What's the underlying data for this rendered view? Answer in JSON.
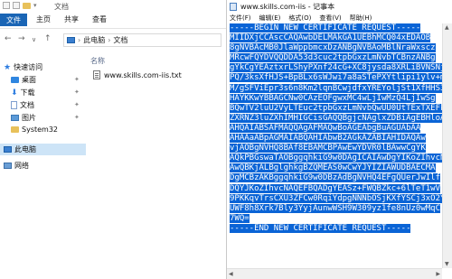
{
  "explorer": {
    "window_title": "文档",
    "tabs": [
      "文件",
      "主页",
      "共享",
      "查看"
    ],
    "address": {
      "part1": "此电脑",
      "part2": "文档"
    },
    "nav": {
      "quick_access": "快速访问",
      "items": [
        {
          "label": "桌面"
        },
        {
          "label": "下载"
        },
        {
          "label": "文档"
        },
        {
          "label": "图片"
        },
        {
          "label": "System32"
        }
      ],
      "this_pc": "此电脑",
      "network": "网络"
    },
    "column_name": "名称",
    "file_name": "www.skills.com-iis.txt"
  },
  "notepad": {
    "window_title": "www.skills.com-iis - 记事本",
    "menu": [
      "文件(F)",
      "编辑(E)",
      "格式(O)",
      "查看(V)",
      "帮助(H)"
    ],
    "lines": [
      "-----BEGIN NEW CERTIFICATE REQUEST-----",
      "MIIDXjCCAscCAQAwbDELMAkGA1UEBhMCQ04xEDAOB",
      "8gNVBAcMB0JlaWppbmcxDzANBgNVBAoMBlNraWxscz",
      "MRcwFQYDVQQDDA53d3cuc2tpbGxzLmNvbTCBnzANBg",
      "gYkCgYEAztxrLShyPXnf24cG+XC8jysda8XRLiBVNSNjaX8",
      "PQ/3ksXfHJS+BpBLx6sWJwi7a8aSTePXYtlipi1ylv+mtCfU",
      "M/gSFViEpr3s6n8Km2lqnBCwjdfxYREYoljSt1XfHHS3wHd",
      "HAYKKwYBBAGCNw0CAzEOFgwxMC4wLjIwMzQ4LjIwSg",
      "BQwTV2luU2VyLTEuc2tpbGxzLmNvbQwUU0UtTExTXEFkb",
      "ZXRNZ3luZXhIMHIGCisGAQQBgjcNAglxZDBiAgEBHloAT",
      "AHQAIABSAFMAQQAgAFMAQwBoAGEAbgBuAGUAbAA",
      "AHAAaABpAGMAIABQAHIAbwB2AGkAZABIAHIDAQAw",
      "vjAOBgNVHQ8BAf8EBAMCBPAwEwYDVR0lBAwwCgYK",
      "AQkPBGswaTAOBggqhkiG9w0DAgICAIAwDgYIKoZIhvcN",
      "AwQBKjALBglghkgBZQMEAS0wCwYJYIZIAWUDBAECMA",
      "DgMCBzAKBggqhkiG9w0DBzAdBgNVHQ4EFgQUerJwIlf",
      "DQYJKoZIhvcNAQEFBQADgYEASz+FWQBZkc+6lTeT1wV",
      "9PKKqvTrsCXU3ZFCw0RqiYdpgNNNbOSjKXfYSCj3xO2Yv",
      "UWF8h8Xrk7Bly3YyjAunwWSH9W309yz1fe8nUz0wMqC",
      "7WQ=",
      "-----END NEW CERTIFICATE REQUEST-----"
    ]
  },
  "colors": {
    "accent": "#1a65b5",
    "selection": "#0a64d6",
    "nav_selected": "#cde4f7"
  }
}
